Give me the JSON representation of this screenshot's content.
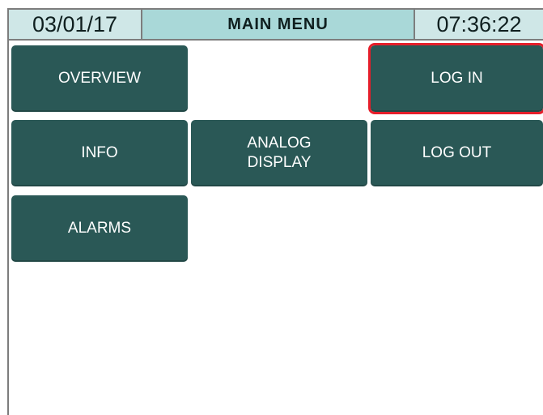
{
  "header": {
    "date": "03/01/17",
    "title": "MAIN MENU",
    "time": "07:36:22"
  },
  "buttons": {
    "overview": "OVERVIEW",
    "login": "LOG IN",
    "info": "INFO",
    "analog_display": "ANALOG\nDISPLAY",
    "logout": "LOG OUT",
    "alarms": "ALARMS"
  },
  "colors": {
    "button": "#2a5856",
    "header": "#cfe7e7",
    "title": "#a9d8d8",
    "selection": "#e61e2a"
  }
}
